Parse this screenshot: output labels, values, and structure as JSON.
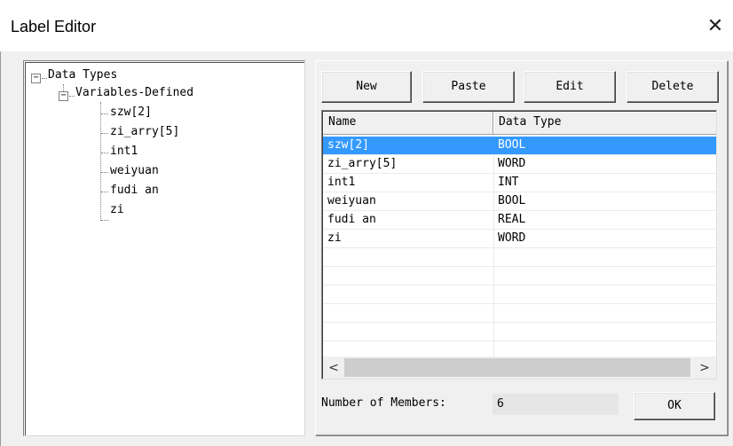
{
  "window": {
    "title": "Label Editor",
    "close_glyph": "✕"
  },
  "tree": {
    "root": {
      "label": "Data Types",
      "expander": "−"
    },
    "group": {
      "label": "Variables-Defined",
      "expander": "−"
    },
    "items": [
      {
        "label": "szw[2]"
      },
      {
        "label": "zi_arry[5]"
      },
      {
        "label": "int1"
      },
      {
        "label": "weiyuan"
      },
      {
        "label": "fudi an"
      },
      {
        "label": "zi"
      }
    ]
  },
  "toolbar": {
    "new_label": "New",
    "paste_label": "Paste",
    "edit_label": "Edit",
    "delete_label": "Delete"
  },
  "list": {
    "columns": [
      "Name",
      "Data Type"
    ],
    "rows": [
      {
        "name": "szw[2]",
        "type": "BOOL",
        "selected": true
      },
      {
        "name": "zi_arry[5]",
        "type": "WORD",
        "selected": false
      },
      {
        "name": "int1",
        "type": "INT",
        "selected": false
      },
      {
        "name": "weiyuan",
        "type": "BOOL",
        "selected": false
      },
      {
        "name": "fudi an",
        "type": "REAL",
        "selected": false
      },
      {
        "name": "zi",
        "type": "WORD",
        "selected": false
      }
    ],
    "scroll_left_glyph": "<",
    "scroll_right_glyph": ">"
  },
  "footer": {
    "members_label": "Number of Members:",
    "members_value": "6",
    "ok_label": "OK"
  },
  "colors": {
    "selection": "#3399ff",
    "dialog_bg": "#f0f0f0"
  }
}
